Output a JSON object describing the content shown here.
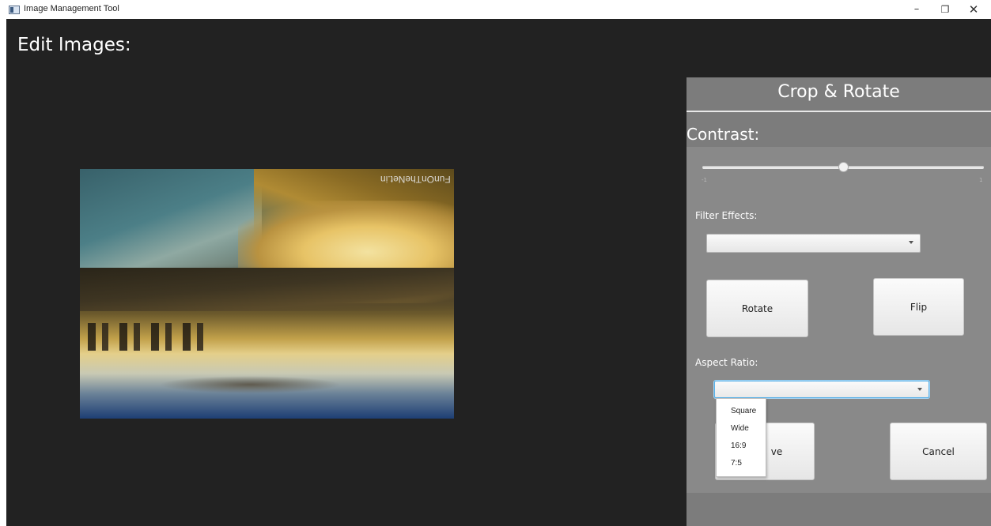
{
  "window": {
    "title": "Image Management Tool",
    "controls": {
      "minimize": "–",
      "maximize": "❐",
      "close": "✕"
    }
  },
  "main": {
    "title": "Edit Images:",
    "image": {
      "watermark": "FunOnTheNet.in"
    }
  },
  "panel": {
    "header": "Crop & Rotate",
    "contrast": {
      "label": "Contrast:",
      "min_label": "-1",
      "max_label": "1",
      "value_fraction": 0.5
    },
    "filter": {
      "label": "Filter Effects:",
      "selected": ""
    },
    "buttons": {
      "rotate": "Rotate",
      "flip": "Flip",
      "save": "Save",
      "save_visible": "ve",
      "cancel": "Cancel"
    },
    "aspect": {
      "label": "Aspect Ratio:",
      "selected": "",
      "options": [
        "Square",
        "Wide",
        "16:9",
        "7:5"
      ]
    }
  },
  "colors": {
    "window_bg": "#222222",
    "panel_bg": "#7c7c7c",
    "focus_blue": "#56b0e8"
  }
}
